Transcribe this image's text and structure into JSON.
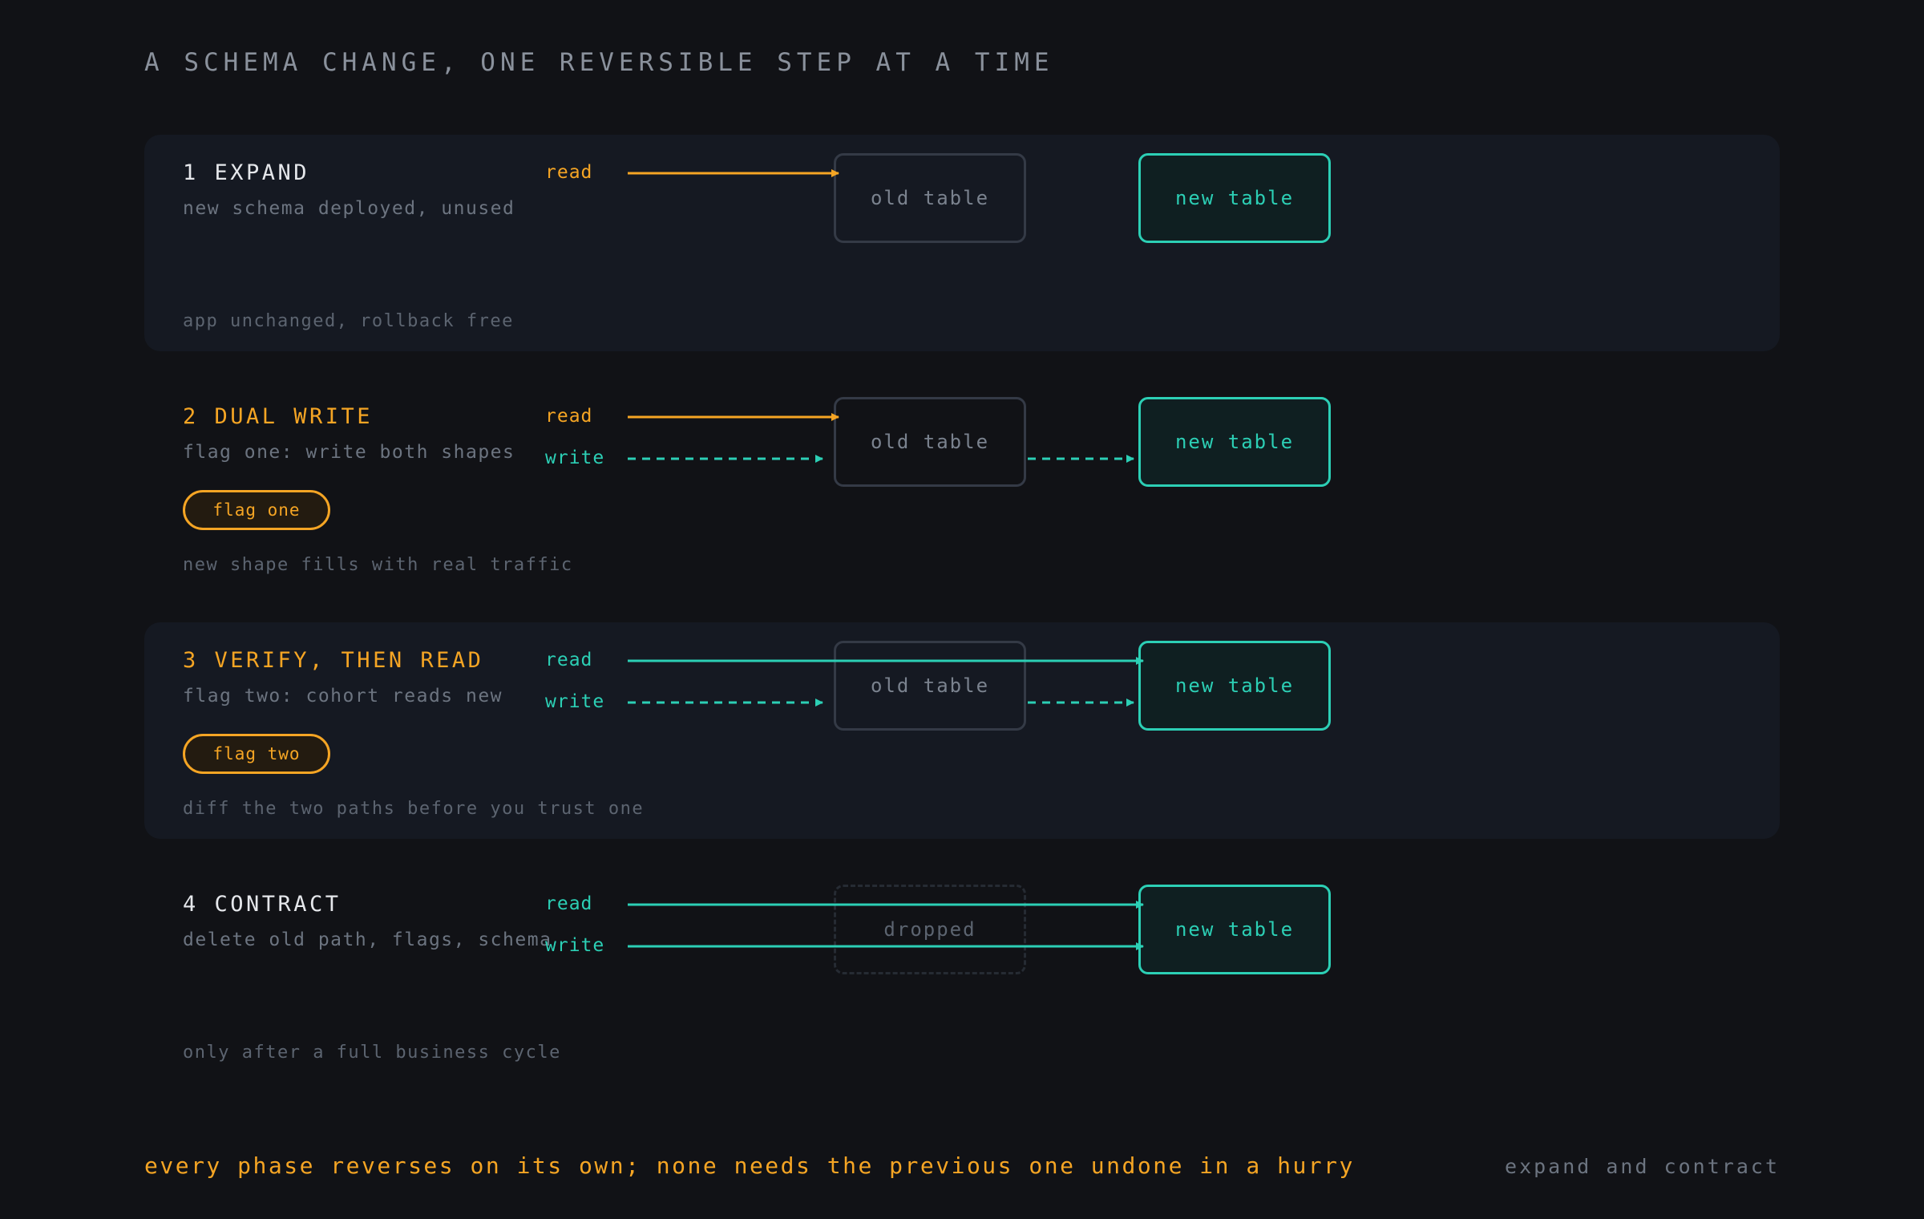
{
  "title": "A SCHEMA CHANGE, ONE REVERSIBLE STEP AT A TIME",
  "colors": {
    "accent_orange": "#f5a524",
    "accent_teal": "#2ccfb5",
    "muted": "#6c7480",
    "background": "#111216",
    "band": "#151922"
  },
  "labels": {
    "read": "read",
    "write": "write",
    "old_table": "old table",
    "new_table": "new table",
    "dropped": "dropped"
  },
  "steps": [
    {
      "title": "1 EXPAND",
      "subtitle": "new schema deployed, unused",
      "note": "app unchanged, rollback free",
      "flag": "",
      "title_color": "#e5e7eb",
      "read_color": "#f5a524",
      "read_target": "old table",
      "write_target": ""
    },
    {
      "title": "2 DUAL WRITE",
      "subtitle": "flag one: write both shapes",
      "note": "new shape fills with real traffic",
      "flag": "flag one",
      "title_color": "#f5a524",
      "read_color": "#f5a524",
      "read_target": "old table",
      "write_target": "both (dashed)"
    },
    {
      "title": "3 VERIFY, THEN READ",
      "subtitle": "flag two: cohort reads new",
      "note": "diff the two paths before you trust one",
      "flag": "flag two",
      "title_color": "#f5a524",
      "read_color": "#2ccfb5",
      "read_target": "new table",
      "write_target": "both (dashed)"
    },
    {
      "title": "4 CONTRACT",
      "subtitle": "delete old path, flags, schema",
      "note": "only after a full business cycle",
      "flag": "",
      "title_color": "#e5e7eb",
      "read_color": "#2ccfb5",
      "read_target": "new table",
      "write_target": "new table"
    }
  ],
  "footer": {
    "tagline": "every phase reverses on its own; none needs the previous one undone in a hurry",
    "caption": "expand and contract"
  }
}
